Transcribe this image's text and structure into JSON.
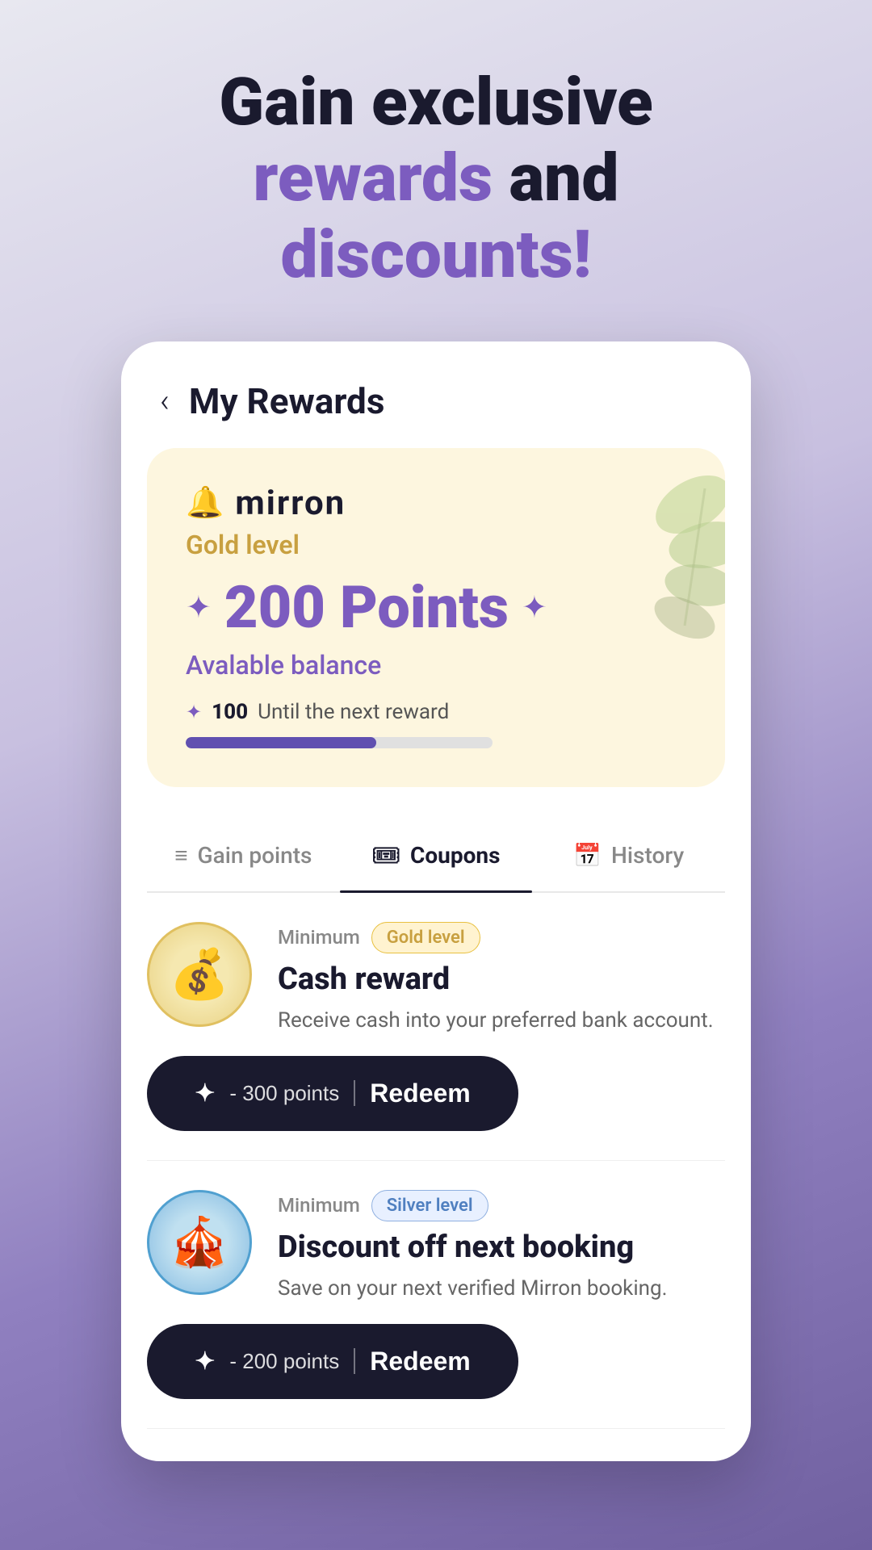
{
  "hero": {
    "line1": "Gain exclusive",
    "line2_accent": "rewards",
    "line2_normal": " and",
    "line3_accent": "discounts!"
  },
  "header": {
    "back_label": "‹",
    "title": "My Rewards"
  },
  "rewards_card": {
    "brand_icon": "🔔",
    "brand_name": "mirron",
    "level": "Gold level",
    "points_value": "200 Points",
    "available_label": "Avalable balance",
    "next_reward_prefix": "✦",
    "next_reward_num": "100",
    "next_reward_text": "Until the next reward",
    "progress_percent": 62
  },
  "tabs": [
    {
      "id": "gain",
      "label": "Gain points",
      "icon": "≡"
    },
    {
      "id": "coupons",
      "label": "Coupons",
      "icon": "🎟",
      "active": true
    },
    {
      "id": "history",
      "label": "History",
      "icon": "📅"
    }
  ],
  "coupons": [
    {
      "id": "cash-reward",
      "minimum_label": "Minimum",
      "level_badge": "Gold level",
      "level_type": "gold",
      "title": "Cash reward",
      "description": "Receive cash into your preferred bank account.",
      "redeem_points": "- 300 points",
      "redeem_label": "Redeem",
      "img_emoji": "💰"
    },
    {
      "id": "discount-booking",
      "minimum_label": "Minimum",
      "level_badge": "Silver level",
      "level_type": "silver",
      "title": "Discount off next booking",
      "description": "Save on your next verified Mirron booking.",
      "redeem_points": "- 200 points",
      "redeem_label": "Redeem",
      "img_emoji": "🎪"
    }
  ]
}
